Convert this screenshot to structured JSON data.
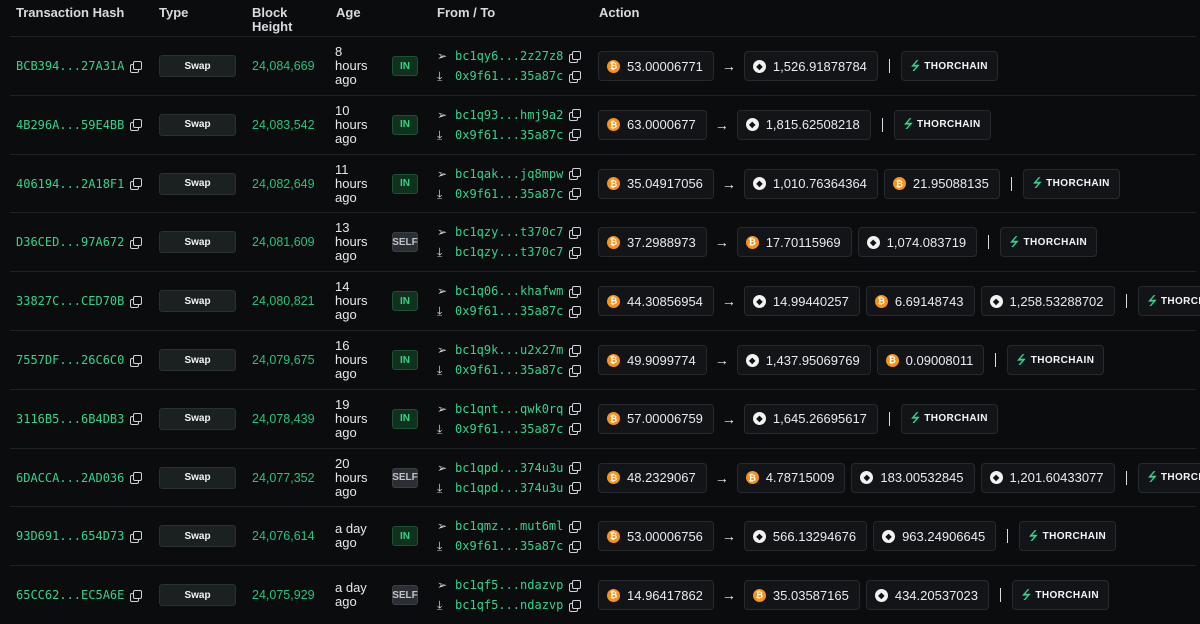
{
  "headers": {
    "hash": "Transaction Hash",
    "type": "Type",
    "block_line1": "Block",
    "block_line2": "Height",
    "age": "Age",
    "fromto": "From / To",
    "action": "Action"
  },
  "icons": {
    "copy": "copy-icon",
    "send": "send-icon",
    "receive": "download-icon",
    "btc": "bitcoin-icon",
    "eth": "ethereum-icon",
    "thorchain": "thorchain-logo-icon"
  },
  "colors": {
    "green": "#35d38a",
    "btc": "#f7931a"
  },
  "rows": [
    {
      "hash": "BCB394...27A31A",
      "type": "Swap",
      "block": "24,084,669",
      "age1": "8",
      "age2": "hours",
      "age3": "ago",
      "badge": "IN",
      "from": "bc1qy6...2z27z8",
      "to": "0x9f61...35a87c",
      "assets": [
        {
          "coin": "btc",
          "amount": "53.00006771"
        },
        {
          "coin": "eth",
          "amount": "1,526.91878784"
        }
      ],
      "thor": "THORCHAIN"
    },
    {
      "hash": "4B296A...59E4BB",
      "type": "Swap",
      "block": "24,083,542",
      "age1": "10",
      "age2": "hours",
      "age3": "ago",
      "badge": "IN",
      "from": "bc1q93...hmj9a2",
      "to": "0x9f61...35a87c",
      "assets": [
        {
          "coin": "btc",
          "amount": "63.0000677"
        },
        {
          "coin": "eth",
          "amount": "1,815.62508218"
        }
      ],
      "thor": "THORCHAIN"
    },
    {
      "hash": "406194...2A18F1",
      "type": "Swap",
      "block": "24,082,649",
      "age1": "11",
      "age2": "hours",
      "age3": "ago",
      "badge": "IN",
      "from": "bc1qak...jq8mpw",
      "to": "0x9f61...35a87c",
      "assets": [
        {
          "coin": "btc",
          "amount": "35.04917056"
        },
        {
          "coin": "eth",
          "amount": "1,010.76364364"
        },
        {
          "coin": "btc",
          "amount": "21.95088135"
        }
      ],
      "thor": "THORCHAIN"
    },
    {
      "hash": "D36CED...97A672",
      "type": "Swap",
      "block": "24,081,609",
      "age1": "13",
      "age2": "hours",
      "age3": "ago",
      "badge": "SELF",
      "from": "bc1qzy...t370c7",
      "to": "bc1qzy...t370c7",
      "assets": [
        {
          "coin": "btc",
          "amount": "37.2988973"
        },
        {
          "coin": "btc",
          "amount": "17.70115969"
        },
        {
          "coin": "eth",
          "amount": "1,074.083719"
        }
      ],
      "thor": "THORCHAIN"
    },
    {
      "hash": "33827C...CED70B",
      "type": "Swap",
      "block": "24,080,821",
      "age1": "14",
      "age2": "hours",
      "age3": "ago",
      "badge": "IN",
      "from": "bc1q06...khafwm",
      "to": "0x9f61...35a87c",
      "assets": [
        {
          "coin": "btc",
          "amount": "44.30856954"
        },
        {
          "coin": "eth",
          "amount": "14.99440257"
        },
        {
          "coin": "btc",
          "amount": "6.69148743"
        },
        {
          "coin": "eth",
          "amount": "1,258.53288702"
        }
      ],
      "thor": "THORCHAIN"
    },
    {
      "hash": "7557DF...26C6C0",
      "type": "Swap",
      "block": "24,079,675",
      "age1": "16",
      "age2": "hours",
      "age3": "ago",
      "badge": "IN",
      "from": "bc1q9k...u2x27m",
      "to": "0x9f61...35a87c",
      "assets": [
        {
          "coin": "btc",
          "amount": "49.9099774"
        },
        {
          "coin": "eth",
          "amount": "1,437.95069769"
        },
        {
          "coin": "btc",
          "amount": "0.09008011"
        }
      ],
      "thor": "THORCHAIN"
    },
    {
      "hash": "3116B5...6B4DB3",
      "type": "Swap",
      "block": "24,078,439",
      "age1": "19",
      "age2": "hours",
      "age3": "ago",
      "badge": "IN",
      "from": "bc1qnt...qwk0rq",
      "to": "0x9f61...35a87c",
      "assets": [
        {
          "coin": "btc",
          "amount": "57.00006759"
        },
        {
          "coin": "eth",
          "amount": "1,645.26695617"
        }
      ],
      "thor": "THORCHAIN"
    },
    {
      "hash": "6DACCA...2AD036",
      "type": "Swap",
      "block": "24,077,352",
      "age1": "20",
      "age2": "hours",
      "age3": "ago",
      "badge": "SELF",
      "from": "bc1qpd...374u3u",
      "to": "bc1qpd...374u3u",
      "assets": [
        {
          "coin": "btc",
          "amount": "48.2329067"
        },
        {
          "coin": "btc",
          "amount": "4.78715009"
        },
        {
          "coin": "eth",
          "amount": "183.00532845"
        },
        {
          "coin": "eth",
          "amount": "1,201.60433077"
        }
      ],
      "thor": "THORCHAIN"
    },
    {
      "hash": "93D691...654D73",
      "type": "Swap",
      "block": "24,076,614",
      "age1": "a day",
      "age2": "ago",
      "age3": "",
      "badge": "IN",
      "from": "bc1qmz...mut6ml",
      "to": "0x9f61...35a87c",
      "assets": [
        {
          "coin": "btc",
          "amount": "53.00006756"
        },
        {
          "coin": "eth",
          "amount": "566.13294676"
        },
        {
          "coin": "eth",
          "amount": "963.24906645"
        }
      ],
      "thor": "THORCHAIN"
    },
    {
      "hash": "65CC62...EC5A6E",
      "type": "Swap",
      "block": "24,075,929",
      "age1": "a day",
      "age2": "ago",
      "age3": "",
      "badge": "SELF",
      "from": "bc1qf5...ndazvp",
      "to": "bc1qf5...ndazvp",
      "assets": [
        {
          "coin": "btc",
          "amount": "14.96417862"
        },
        {
          "coin": "btc",
          "amount": "35.03587165"
        },
        {
          "coin": "eth",
          "amount": "434.20537023"
        }
      ],
      "thor": "THORCHAIN"
    }
  ]
}
